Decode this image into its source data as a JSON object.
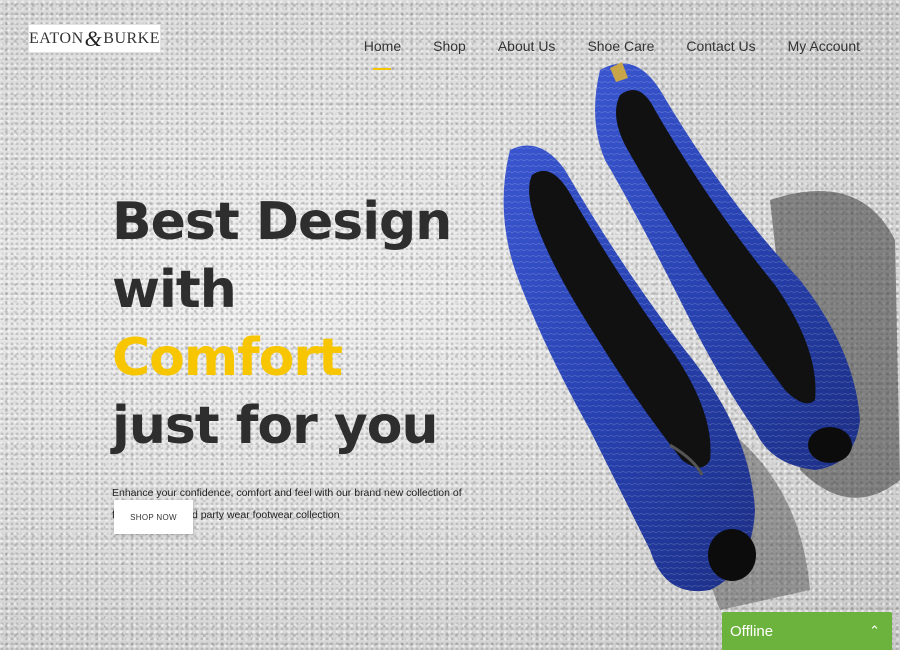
{
  "brand": {
    "left": "EATON",
    "amp": "&",
    "right": "BURKE"
  },
  "nav": {
    "items": [
      {
        "label": "Home",
        "active": true
      },
      {
        "label": "Shop",
        "active": false
      },
      {
        "label": "About Us",
        "active": false
      },
      {
        "label": "Shoe Care",
        "active": false
      },
      {
        "label": "Contact Us",
        "active": false
      },
      {
        "label": "My Account",
        "active": false
      }
    ]
  },
  "hero": {
    "line1": "Best Design",
    "line2_prefix": "with",
    "line2_accent": "Comfort",
    "line3": "just for you",
    "description": "Enhance your confidence, comfort and feel with our brand new collection of formal, casual and party wear footwear collection",
    "cta": "SHOP NOW"
  },
  "chat": {
    "status": "Offline",
    "toggle_icon": "chevron-up-icon"
  },
  "colors": {
    "accent": "#f7c600",
    "chat": "#6cb33e",
    "shoe": "#2f47b8"
  }
}
